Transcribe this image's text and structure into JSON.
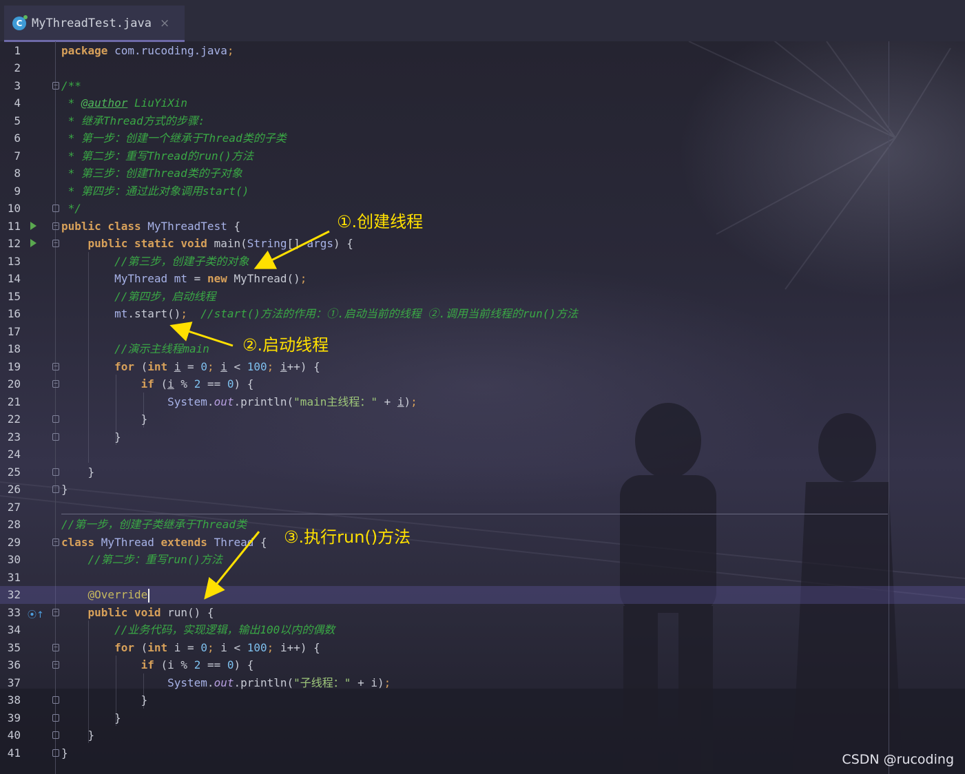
{
  "tab": {
    "icon": "java-class-icon",
    "filename": "MyThreadTest.java",
    "close_glyph": "×"
  },
  "lines": [
    {
      "n": "1",
      "tokens": [
        {
          "t": "package ",
          "c": "kw"
        },
        {
          "t": "com.rucoding.java",
          "c": "cls"
        },
        {
          "t": ";",
          "c": "punc"
        }
      ]
    },
    {
      "n": "2",
      "tokens": []
    },
    {
      "n": "3",
      "tokens": [
        {
          "t": "/**",
          "c": "cm"
        }
      ]
    },
    {
      "n": "4",
      "tokens": [
        {
          "t": " * ",
          "c": "cm"
        },
        {
          "t": "@author",
          "c": "doc-tag"
        },
        {
          "t": " LiuYiXin",
          "c": "cm"
        }
      ]
    },
    {
      "n": "5",
      "tokens": [
        {
          "t": " * 继承Thread方式的步骤:",
          "c": "cm"
        }
      ]
    },
    {
      "n": "6",
      "tokens": [
        {
          "t": " * 第一步：创建一个继承于Thread类的子类",
          "c": "cm"
        }
      ]
    },
    {
      "n": "7",
      "tokens": [
        {
          "t": " * 第二步：重写Thread的run()方法",
          "c": "cm"
        }
      ]
    },
    {
      "n": "8",
      "tokens": [
        {
          "t": " * 第三步：创建Thread类的子对象",
          "c": "cm"
        }
      ]
    },
    {
      "n": "9",
      "tokens": [
        {
          "t": " * 第四步：通过此对象调用start()",
          "c": "cm"
        }
      ]
    },
    {
      "n": "10",
      "tokens": [
        {
          "t": " */",
          "c": "cm"
        }
      ]
    },
    {
      "n": "11",
      "tokens": [
        {
          "t": "public class ",
          "c": "kw"
        },
        {
          "t": "MyThreadTest",
          "c": "cls"
        },
        {
          "t": " {"
        }
      ]
    },
    {
      "n": "12",
      "tokens": [
        {
          "t": "    "
        },
        {
          "t": "public static void ",
          "c": "kw"
        },
        {
          "t": "main("
        },
        {
          "t": "String",
          "c": "cls"
        },
        {
          "t": "[] "
        },
        {
          "t": "args",
          "c": "cls"
        },
        {
          "t": ") {"
        }
      ]
    },
    {
      "n": "13",
      "tokens": [
        {
          "t": "        "
        },
        {
          "t": "//第三步，创建子类的对象",
          "c": "cm"
        }
      ]
    },
    {
      "n": "14",
      "tokens": [
        {
          "t": "        "
        },
        {
          "t": "MyThread ",
          "c": "cls"
        },
        {
          "t": "mt",
          "c": "cls"
        },
        {
          "t": " = "
        },
        {
          "t": "new ",
          "c": "kw"
        },
        {
          "t": "MyThread()"
        },
        {
          "t": ";",
          "c": "punc"
        }
      ]
    },
    {
      "n": "15",
      "tokens": [
        {
          "t": "        "
        },
        {
          "t": "//第四步，启动线程",
          "c": "cm"
        }
      ]
    },
    {
      "n": "16",
      "tokens": [
        {
          "t": "        "
        },
        {
          "t": "mt",
          "c": "cls"
        },
        {
          "t": ".start()"
        },
        {
          "t": ";",
          "c": "punc"
        },
        {
          "t": "  "
        },
        {
          "t": "//start()方法的作用：①.启动当前的线程 ②.调用当前线程的run()方法",
          "c": "cm"
        }
      ]
    },
    {
      "n": "17",
      "tokens": []
    },
    {
      "n": "18",
      "tokens": [
        {
          "t": "        "
        },
        {
          "t": "//演示主线程main",
          "c": "cm"
        }
      ]
    },
    {
      "n": "19",
      "tokens": [
        {
          "t": "        "
        },
        {
          "t": "for ",
          "c": "kw"
        },
        {
          "t": "("
        },
        {
          "t": "int ",
          "c": "kw"
        },
        {
          "t": "i",
          "c": "var-u"
        },
        {
          "t": " = "
        },
        {
          "t": "0",
          "c": "num"
        },
        {
          "t": "; ",
          "c": "punc"
        },
        {
          "t": "i",
          "c": "var-u"
        },
        {
          "t": " < "
        },
        {
          "t": "100",
          "c": "num"
        },
        {
          "t": "; ",
          "c": "punc"
        },
        {
          "t": "i",
          "c": "var-u"
        },
        {
          "t": "++) {"
        }
      ]
    },
    {
      "n": "20",
      "tokens": [
        {
          "t": "            "
        },
        {
          "t": "if ",
          "c": "kw"
        },
        {
          "t": "("
        },
        {
          "t": "i",
          "c": "var-u"
        },
        {
          "t": " % "
        },
        {
          "t": "2",
          "c": "num"
        },
        {
          "t": " == "
        },
        {
          "t": "0",
          "c": "num"
        },
        {
          "t": ") {"
        }
      ]
    },
    {
      "n": "21",
      "tokens": [
        {
          "t": "                "
        },
        {
          "t": "System",
          "c": "cls"
        },
        {
          "t": "."
        },
        {
          "t": "out",
          "c": "fld"
        },
        {
          "t": ".println("
        },
        {
          "t": "\"main主线程：\"",
          "c": "str"
        },
        {
          "t": " + "
        },
        {
          "t": "i",
          "c": "var-u"
        },
        {
          "t": ")"
        },
        {
          "t": ";",
          "c": "punc"
        }
      ]
    },
    {
      "n": "22",
      "tokens": [
        {
          "t": "            }"
        }
      ]
    },
    {
      "n": "23",
      "tokens": [
        {
          "t": "        }"
        }
      ]
    },
    {
      "n": "24",
      "tokens": []
    },
    {
      "n": "25",
      "tokens": [
        {
          "t": "    }"
        }
      ]
    },
    {
      "n": "26",
      "tokens": [
        {
          "t": "}"
        }
      ]
    },
    {
      "n": "27",
      "tokens": []
    },
    {
      "n": "28",
      "tokens": [
        {
          "t": "//第一步，创建子类继承于Thread类",
          "c": "cm"
        }
      ]
    },
    {
      "n": "29",
      "tokens": [
        {
          "t": "class ",
          "c": "kw"
        },
        {
          "t": "MyThread ",
          "c": "cls"
        },
        {
          "t": "extends ",
          "c": "kw"
        },
        {
          "t": "Thread",
          "c": "cls"
        },
        {
          "t": " {"
        }
      ]
    },
    {
      "n": "30",
      "tokens": [
        {
          "t": "    "
        },
        {
          "t": "//第二步：重写run()方法",
          "c": "cm"
        }
      ]
    },
    {
      "n": "31",
      "tokens": []
    },
    {
      "n": "32",
      "tokens": [
        {
          "t": "    "
        },
        {
          "t": "@Override",
          "c": "ann"
        }
      ]
    },
    {
      "n": "33",
      "tokens": [
        {
          "t": "    "
        },
        {
          "t": "public void ",
          "c": "kw"
        },
        {
          "t": "run() {"
        }
      ]
    },
    {
      "n": "34",
      "tokens": [
        {
          "t": "        "
        },
        {
          "t": "//业务代码，实现逻辑，输出100以内的偶数",
          "c": "cm"
        }
      ]
    },
    {
      "n": "35",
      "tokens": [
        {
          "t": "        "
        },
        {
          "t": "for ",
          "c": "kw"
        },
        {
          "t": "("
        },
        {
          "t": "int ",
          "c": "kw"
        },
        {
          "t": "i"
        },
        {
          "t": " = "
        },
        {
          "t": "0",
          "c": "num"
        },
        {
          "t": "; ",
          "c": "punc"
        },
        {
          "t": "i"
        },
        {
          "t": " < "
        },
        {
          "t": "100",
          "c": "num"
        },
        {
          "t": "; ",
          "c": "punc"
        },
        {
          "t": "i"
        },
        {
          "t": "++) {"
        }
      ]
    },
    {
      "n": "36",
      "tokens": [
        {
          "t": "            "
        },
        {
          "t": "if ",
          "c": "kw"
        },
        {
          "t": "("
        },
        {
          "t": "i"
        },
        {
          "t": " % "
        },
        {
          "t": "2",
          "c": "num"
        },
        {
          "t": " == "
        },
        {
          "t": "0",
          "c": "num"
        },
        {
          "t": ") {"
        }
      ]
    },
    {
      "n": "37",
      "tokens": [
        {
          "t": "                "
        },
        {
          "t": "System",
          "c": "cls"
        },
        {
          "t": "."
        },
        {
          "t": "out",
          "c": "fld"
        },
        {
          "t": ".println("
        },
        {
          "t": "\"子线程：\"",
          "c": "str"
        },
        {
          "t": " + "
        },
        {
          "t": "i"
        },
        {
          "t": ")"
        },
        {
          "t": ";",
          "c": "punc"
        }
      ]
    },
    {
      "n": "38",
      "tokens": [
        {
          "t": "            }"
        }
      ]
    },
    {
      "n": "39",
      "tokens": [
        {
          "t": "        }"
        }
      ]
    },
    {
      "n": "40",
      "tokens": [
        {
          "t": "    }"
        }
      ]
    },
    {
      "n": "41",
      "tokens": [
        {
          "t": "}"
        }
      ]
    }
  ],
  "gutter": {
    "run_lines": [
      "11",
      "12"
    ],
    "override_line": "33",
    "fold_open_lines": [
      "3",
      "11",
      "12",
      "19",
      "20",
      "29",
      "33",
      "35",
      "36"
    ],
    "fold_close_lines": [
      "10",
      "22",
      "23",
      "25",
      "26",
      "38",
      "39",
      "40",
      "41"
    ],
    "current_line": "32"
  },
  "annotations": {
    "note1": "①.创建线程",
    "note2": "②.启动线程",
    "note3": "③.执行run()方法",
    "arrow_color": "#ffe000"
  },
  "watermark": "CSDN @rucoding",
  "colors": {
    "keyword": "#d8a15a",
    "class": "#a8b3e8",
    "comment": "#3aa845",
    "number": "#7ec0ee",
    "string": "#9ec77a",
    "annotation": "#c7b95e"
  }
}
